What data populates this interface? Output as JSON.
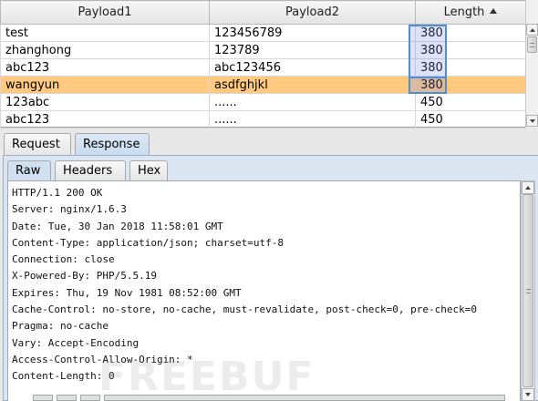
{
  "table": {
    "columns": [
      "Payload1",
      "Payload2",
      "Length"
    ],
    "rows": [
      {
        "payload1": "test",
        "payload2": "123456789",
        "length": "380"
      },
      {
        "payload1": "zhanghong",
        "payload2": "123789",
        "length": "380"
      },
      {
        "payload1": "abc123",
        "payload2": "abc123456",
        "length": "380"
      },
      {
        "payload1": "wangyun",
        "payload2": "asdfghjkl",
        "length": "380",
        "selected": true
      },
      {
        "payload1": "123abc",
        "payload2": "......",
        "length": "450"
      },
      {
        "payload1": "abc123",
        "payload2": "......",
        "length": "450"
      }
    ],
    "sort_column": "Length",
    "sort_direction": "ascending",
    "selected_row_color": "#ffca80",
    "highlight_color": "#4b8fd8"
  },
  "tabs": {
    "outer": [
      "Request",
      "Response"
    ],
    "outer_active": "Response",
    "inner": [
      "Raw",
      "Headers",
      "Hex"
    ],
    "inner_active": "Raw"
  },
  "response_raw": [
    "HTTP/1.1 200 OK",
    "Server: nginx/1.6.3",
    "Date: Tue, 30 Jan 2018 11:58:01 GMT",
    "Content-Type: application/json; charset=utf-8",
    "Connection: close",
    "X-Powered-By: PHP/5.5.19",
    "Expires: Thu, 19 Nov 1981 08:52:00 GMT",
    "Cache-Control: no-store, no-cache, must-revalidate, post-check=0, pre-check=0",
    "Pragma: no-cache",
    "Vary: Accept-Encoding",
    "Access-Control-Allow-Origin: *",
    "Content-Length: 0"
  ],
  "watermark": "FREEBUF"
}
